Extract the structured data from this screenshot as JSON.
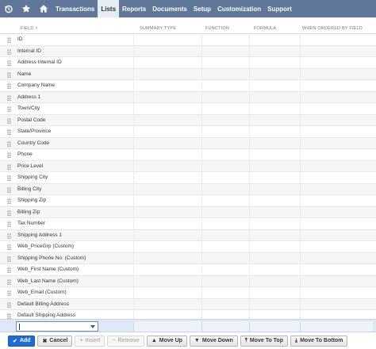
{
  "nav": {
    "items": [
      "Transactions",
      "Lists",
      "Reports",
      "Documents",
      "Setup",
      "Customization",
      "Support"
    ],
    "active": "Lists"
  },
  "table": {
    "headers": {
      "field": "FIELD ˄",
      "summary_type": "SUMMARY TYPE",
      "function": "FUNCTION",
      "formula": "FORMULA",
      "when_ordered": "WHEN ORDERED BY FIELD"
    },
    "rows": [
      "ID",
      "Internal ID",
      "Address Internal ID",
      "Name",
      "Company Name",
      "Address 1",
      "Town/City",
      "Postal Code",
      "State/Province",
      "Country Code",
      "Phone",
      "Price Level",
      "Shipping City",
      "Billing City",
      "Shipping Zip",
      "Billing Zip",
      "Tax Number",
      "Shipping Address 1",
      "Web_PriceGrp (Custom)",
      "Shipping Phone No: (Custom)",
      "Web_First Name (Custom)",
      "Web_Last Name (Custom)",
      "Web_Email (Custom)",
      "Default Billing Address",
      "Default Shipping Address"
    ]
  },
  "buttons": {
    "add": "Add",
    "cancel": "Cancel",
    "insert": "Insert",
    "remove": "Remove",
    "move_up": "Move Up",
    "move_down": "Move Down",
    "move_to_top": "Move To Top",
    "move_to_bottom": "Move To Bottom"
  },
  "colors": {
    "navbar": "#607799",
    "primary_button": "#1e6bd6",
    "edit_row": "#dfe9f5"
  }
}
